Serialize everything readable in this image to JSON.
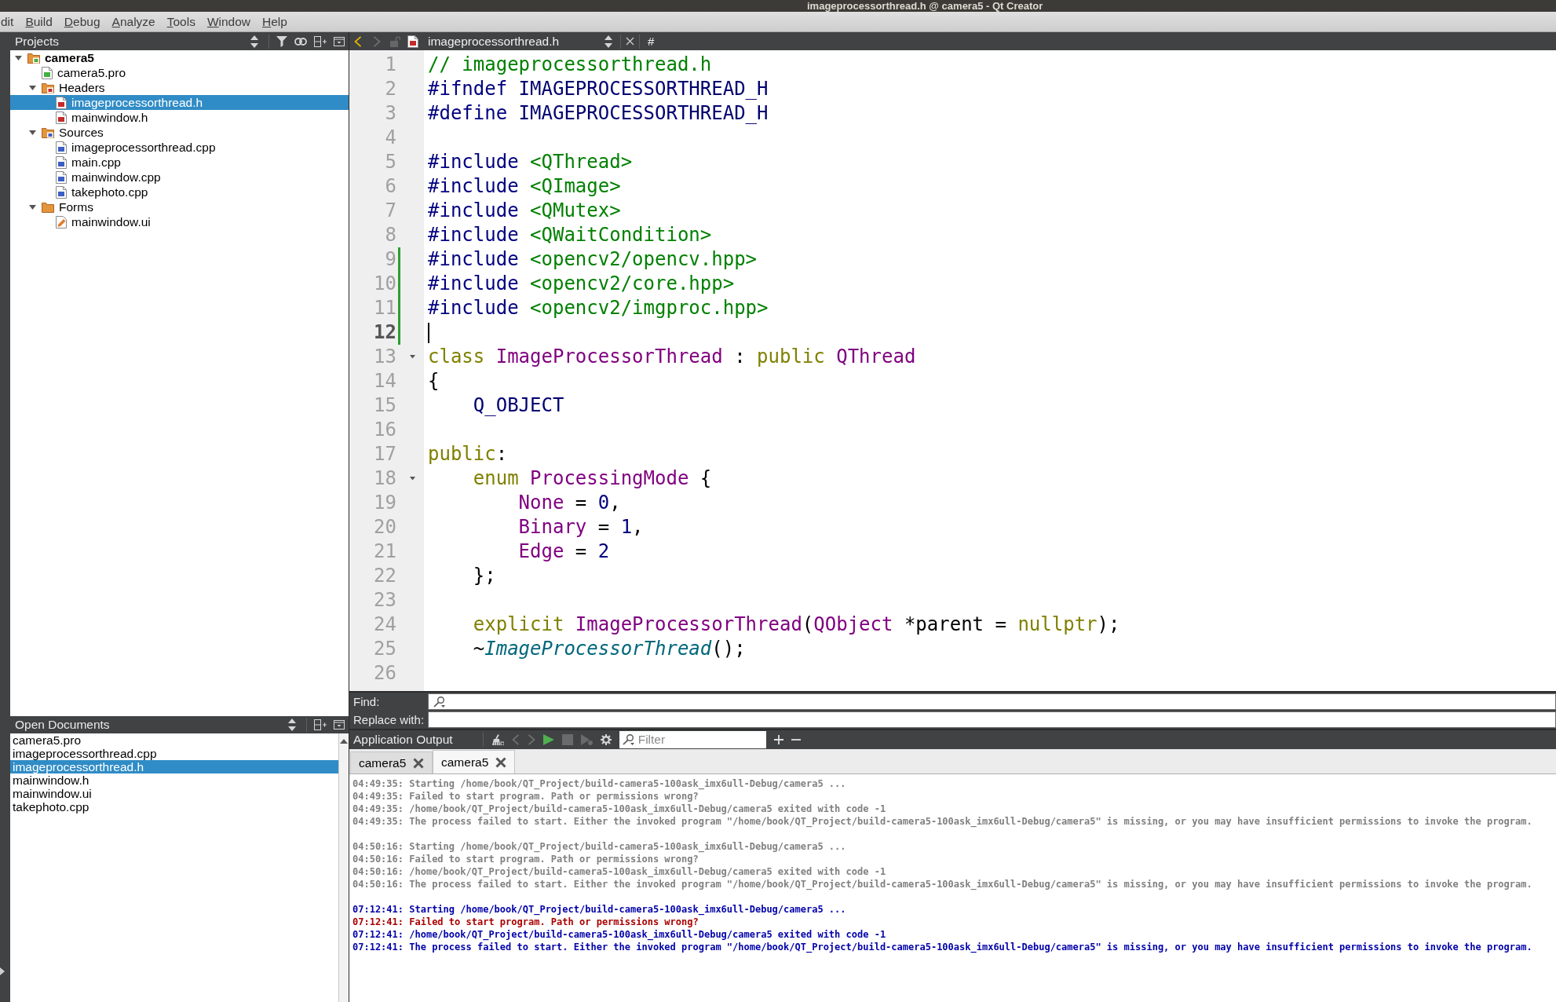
{
  "window": {
    "title": "imageprocessorthread.h @ camera5 - Qt Creator"
  },
  "menu": [
    {
      "label": "dit",
      "mnemonic": false
    },
    {
      "label": "Build",
      "mnemonic": true
    },
    {
      "label": "Debug",
      "mnemonic": true
    },
    {
      "label": "Analyze",
      "mnemonic": true
    },
    {
      "label": "Tools",
      "mnemonic": true
    },
    {
      "label": "Window",
      "mnemonic": true
    },
    {
      "label": "Help",
      "mnemonic": true
    }
  ],
  "projects": {
    "title": "Projects",
    "tree": [
      {
        "label": "camera5",
        "kind": "project",
        "expanded": true,
        "selected": false,
        "children": [
          {
            "label": "camera5.pro",
            "kind": "pro",
            "selected": false
          },
          {
            "label": "Headers",
            "kind": "headers",
            "expanded": true,
            "selected": false,
            "children": [
              {
                "label": "imageprocessorthread.h",
                "kind": "header",
                "selected": true
              },
              {
                "label": "mainwindow.h",
                "kind": "header",
                "selected": false
              }
            ]
          },
          {
            "label": "Sources",
            "kind": "sources",
            "expanded": true,
            "selected": false,
            "children": [
              {
                "label": "imageprocessorthread.cpp",
                "kind": "source",
                "selected": false
              },
              {
                "label": "main.cpp",
                "kind": "source",
                "selected": false
              },
              {
                "label": "mainwindow.cpp",
                "kind": "source",
                "selected": false
              },
              {
                "label": "takephoto.cpp",
                "kind": "source",
                "selected": false
              }
            ]
          },
          {
            "label": "Forms",
            "kind": "forms",
            "expanded": true,
            "selected": false,
            "children": [
              {
                "label": "mainwindow.ui",
                "kind": "form",
                "selected": false
              }
            ]
          }
        ]
      }
    ]
  },
  "editor": {
    "file": "imageprocessorthread.h",
    "symbol": "#",
    "lines": [
      {
        "number": "1",
        "current": false,
        "modified": false,
        "foldable": false,
        "tokens": [
          {
            "kind": "comment",
            "text": "// imageprocessorthread.h"
          }
        ]
      },
      {
        "number": "2",
        "current": false,
        "modified": false,
        "foldable": false,
        "tokens": [
          {
            "kind": "preprocessor",
            "text": "#ifndef "
          },
          {
            "kind": "macro",
            "text": "IMAGEPROCESSORTHREAD_H"
          }
        ]
      },
      {
        "number": "3",
        "current": false,
        "modified": false,
        "foldable": false,
        "tokens": [
          {
            "kind": "preprocessor",
            "text": "#define "
          },
          {
            "kind": "macro",
            "text": "IMAGEPROCESSORTHREAD_H"
          }
        ]
      },
      {
        "number": "4",
        "current": false,
        "modified": false,
        "foldable": false
      },
      {
        "number": "5",
        "current": false,
        "modified": false,
        "foldable": false,
        "tokens": [
          {
            "kind": "preprocessor",
            "text": "#include "
          },
          {
            "kind": "string",
            "text": "<QThread>"
          }
        ]
      },
      {
        "number": "6",
        "current": false,
        "modified": false,
        "foldable": false,
        "tokens": [
          {
            "kind": "preprocessor",
            "text": "#include "
          },
          {
            "kind": "string",
            "text": "<QImage>"
          }
        ]
      },
      {
        "number": "7",
        "current": false,
        "modified": false,
        "foldable": false,
        "tokens": [
          {
            "kind": "preprocessor",
            "text": "#include "
          },
          {
            "kind": "string",
            "text": "<QMutex>"
          }
        ]
      },
      {
        "number": "8",
        "current": false,
        "modified": false,
        "foldable": false,
        "tokens": [
          {
            "kind": "preprocessor",
            "text": "#include "
          },
          {
            "kind": "string",
            "text": "<QWaitCondition>"
          }
        ]
      },
      {
        "number": "9",
        "current": false,
        "modified": true,
        "foldable": false,
        "tokens": [
          {
            "kind": "preprocessor",
            "text": "#include "
          },
          {
            "kind": "string",
            "text": "<opencv2/opencv.hpp>"
          }
        ]
      },
      {
        "number": "10",
        "current": false,
        "modified": true,
        "foldable": false,
        "tokens": [
          {
            "kind": "preprocessor",
            "text": "#include "
          },
          {
            "kind": "string",
            "text": "<opencv2/core.hpp>"
          }
        ]
      },
      {
        "number": "11",
        "current": false,
        "modified": true,
        "foldable": false,
        "tokens": [
          {
            "kind": "preprocessor",
            "text": "#include "
          },
          {
            "kind": "string",
            "text": "<opencv2/imgproc.hpp>"
          }
        ]
      },
      {
        "number": "12",
        "current": true,
        "modified": true,
        "foldable": false
      },
      {
        "number": "13",
        "current": false,
        "modified": false,
        "foldable": true,
        "tokens": [
          {
            "kind": "keyword",
            "text": "class "
          },
          {
            "kind": "type",
            "text": "ImageProcessorThread"
          },
          {
            "kind": "plain",
            "text": " : "
          },
          {
            "kind": "keyword",
            "text": "public "
          },
          {
            "kind": "type",
            "text": "QThread"
          }
        ]
      },
      {
        "number": "14",
        "current": false,
        "modified": false,
        "foldable": false,
        "tokens": [
          {
            "kind": "plain",
            "text": "{"
          }
        ]
      },
      {
        "number": "15",
        "current": false,
        "modified": false,
        "foldable": false,
        "tokens": [
          {
            "kind": "macro",
            "text": "    Q_OBJECT"
          }
        ]
      },
      {
        "number": "16",
        "current": false,
        "modified": false,
        "foldable": false
      },
      {
        "number": "17",
        "current": false,
        "modified": false,
        "foldable": false,
        "tokens": [
          {
            "kind": "keyword",
            "text": "public"
          },
          {
            "kind": "plain",
            "text": ":"
          }
        ]
      },
      {
        "number": "18",
        "current": false,
        "modified": false,
        "foldable": true,
        "tokens": [
          {
            "kind": "keyword",
            "text": "    enum "
          },
          {
            "kind": "type",
            "text": "ProcessingMode"
          },
          {
            "kind": "plain",
            "text": " {"
          }
        ]
      },
      {
        "number": "19",
        "current": false,
        "modified": false,
        "foldable": false,
        "tokens": [
          {
            "kind": "enum",
            "text": "        None"
          },
          {
            "kind": "plain",
            "text": " = "
          },
          {
            "kind": "number",
            "text": "0"
          },
          {
            "kind": "plain",
            "text": ","
          }
        ]
      },
      {
        "number": "20",
        "current": false,
        "modified": false,
        "foldable": false,
        "tokens": [
          {
            "kind": "enum",
            "text": "        Binary"
          },
          {
            "kind": "plain",
            "text": " = "
          },
          {
            "kind": "number",
            "text": "1"
          },
          {
            "kind": "plain",
            "text": ","
          }
        ]
      },
      {
        "number": "21",
        "current": false,
        "modified": false,
        "foldable": false,
        "tokens": [
          {
            "kind": "enum",
            "text": "        Edge"
          },
          {
            "kind": "plain",
            "text": " = "
          },
          {
            "kind": "number",
            "text": "2"
          }
        ]
      },
      {
        "number": "22",
        "current": false,
        "modified": false,
        "foldable": false,
        "tokens": [
          {
            "kind": "plain",
            "text": "    };"
          }
        ]
      },
      {
        "number": "23",
        "current": false,
        "modified": false,
        "foldable": false
      },
      {
        "number": "24",
        "current": false,
        "modified": false,
        "foldable": false,
        "tokens": [
          {
            "kind": "keyword",
            "text": "    explicit "
          },
          {
            "kind": "type",
            "text": "ImageProcessorThread"
          },
          {
            "kind": "plain",
            "text": "("
          },
          {
            "kind": "type",
            "text": "QObject"
          },
          {
            "kind": "plain",
            "text": " *parent = "
          },
          {
            "kind": "keyword",
            "text": "nullptr"
          },
          {
            "kind": "plain",
            "text": ");"
          }
        ]
      },
      {
        "number": "25",
        "current": false,
        "modified": false,
        "foldable": false,
        "tokens": [
          {
            "kind": "plain",
            "text": "    ~"
          },
          {
            "kind": "function",
            "text": "ImageProcessorThread"
          },
          {
            "kind": "plain",
            "text": "();"
          }
        ]
      },
      {
        "number": "26",
        "current": false,
        "modified": false,
        "foldable": false
      }
    ]
  },
  "find_bar": {
    "find_label": "Find:",
    "replace_label": "Replace with:"
  },
  "output": {
    "title": "Application Output",
    "filter": {
      "placeholder": "Filter"
    },
    "tabs": [
      {
        "label": "camera5",
        "selected": false
      },
      {
        "label": "camera5",
        "selected": true
      }
    ],
    "runs": [
      {
        "stale": true,
        "lines": [
          {
            "text": "04:49:35: Starting /home/book/QT_Project/build-camera5-100ask_imx6ull-Debug/camera5 ..."
          },
          {
            "text": "04:49:35: Failed to start program. Path or permissions wrong?"
          },
          {
            "text": "04:49:35: /home/book/QT_Project/build-camera5-100ask_imx6ull-Debug/camera5 exited with code -1"
          },
          {
            "text": "04:49:35: The process failed to start. Either the invoked program \"/home/book/QT_Project/build-camera5-100ask_imx6ull-Debug/camera5\" is missing, or you may have insufficient permissions to invoke the program."
          }
        ]
      },
      {
        "stale": true,
        "lines": [
          {
            "text": "04:50:16: Starting /home/book/QT_Project/build-camera5-100ask_imx6ull-Debug/camera5 ..."
          },
          {
            "text": "04:50:16: Failed to start program. Path or permissions wrong?"
          },
          {
            "text": "04:50:16: /home/book/QT_Project/build-camera5-100ask_imx6ull-Debug/camera5 exited with code -1"
          },
          {
            "text": "04:50:16: The process failed to start. Either the invoked program \"/home/book/QT_Project/build-camera5-100ask_imx6ull-Debug/camera5\" is missing, or you may have insufficient permissions to invoke the program."
          }
        ]
      },
      {
        "stale": false,
        "lines": [
          {
            "kind": "info",
            "text": "07:12:41: Starting /home/book/QT_Project/build-camera5-100ask_imx6ull-Debug/camera5 ..."
          },
          {
            "kind": "error",
            "text": "07:12:41: Failed to start program. Path or permissions wrong?"
          },
          {
            "kind": "info",
            "text": "07:12:41: /home/book/QT_Project/build-camera5-100ask_imx6ull-Debug/camera5 exited with code -1"
          },
          {
            "kind": "info",
            "text": "07:12:41: The process failed to start. Either the invoked program \"/home/book/QT_Project/build-camera5-100ask_imx6ull-Debug/camera5\" is missing, or you may have insufficient permissions to invoke the program."
          }
        ]
      }
    ]
  },
  "open_documents": {
    "title": "Open Documents",
    "items": [
      {
        "label": "camera5.pro",
        "selected": false
      },
      {
        "label": "imageprocessorthread.cpp",
        "selected": false
      },
      {
        "label": "imageprocessorthread.h",
        "selected": true
      },
      {
        "label": "mainwindow.h",
        "selected": false
      },
      {
        "label": "mainwindow.ui",
        "selected": false
      },
      {
        "label": "takephoto.cpp",
        "selected": false
      }
    ]
  }
}
